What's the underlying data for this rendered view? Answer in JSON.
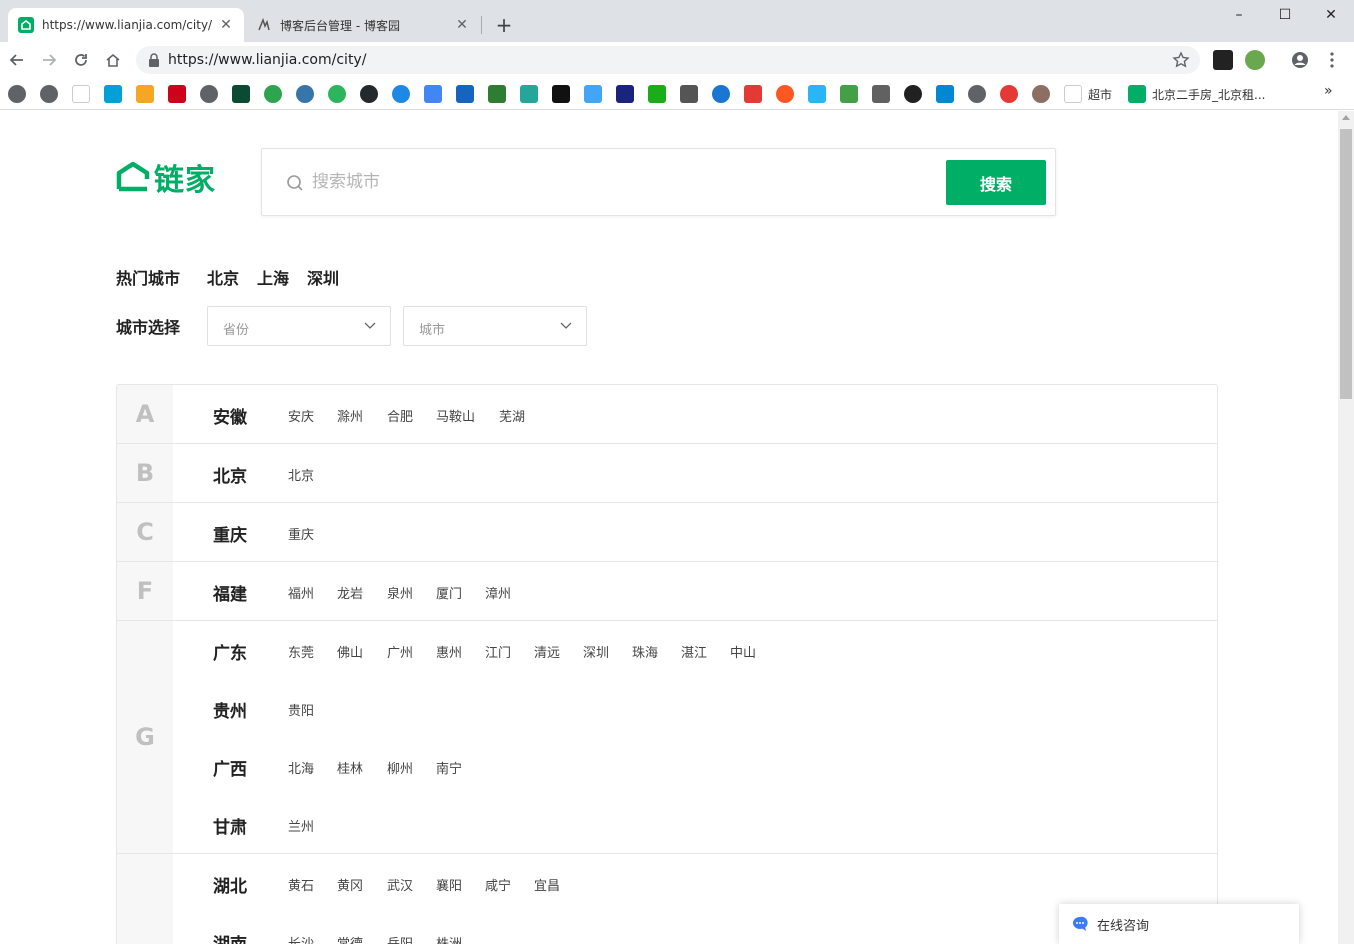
{
  "browser": {
    "tabs": [
      {
        "title": "https://www.lianjia.com/city/",
        "active": true
      },
      {
        "title": "博客后台管理 - 博客园",
        "active": false
      }
    ],
    "url": "https://www.lianjia.com/city/",
    "bookmarks": [
      {
        "label": "超市"
      },
      {
        "label": "北京二手房_北京租..."
      }
    ]
  },
  "site": {
    "logo_text": "链家",
    "brand_color": "#00ae66"
  },
  "search": {
    "placeholder": "搜索城市",
    "button_label": "搜索"
  },
  "hot": {
    "label": "热门城市",
    "cities": [
      "北京",
      "上海",
      "深圳"
    ]
  },
  "select": {
    "label": "城市选择",
    "province_placeholder": "省份",
    "city_placeholder": "城市"
  },
  "groups": [
    {
      "letter": "A",
      "provinces": [
        {
          "name": "安徽",
          "cities": [
            "安庆",
            "滁州",
            "合肥",
            "马鞍山",
            "芜湖"
          ]
        }
      ]
    },
    {
      "letter": "B",
      "provinces": [
        {
          "name": "北京",
          "cities": [
            "北京"
          ]
        }
      ]
    },
    {
      "letter": "C",
      "provinces": [
        {
          "name": "重庆",
          "cities": [
            "重庆"
          ]
        }
      ]
    },
    {
      "letter": "F",
      "provinces": [
        {
          "name": "福建",
          "cities": [
            "福州",
            "龙岩",
            "泉州",
            "厦门",
            "漳州"
          ]
        }
      ]
    },
    {
      "letter": "G",
      "provinces": [
        {
          "name": "广东",
          "cities": [
            "东莞",
            "佛山",
            "广州",
            "惠州",
            "江门",
            "清远",
            "深圳",
            "珠海",
            "湛江",
            "中山"
          ]
        },
        {
          "name": "贵州",
          "cities": [
            "贵阳"
          ]
        },
        {
          "name": "广西",
          "cities": [
            "北海",
            "桂林",
            "柳州",
            "南宁"
          ]
        },
        {
          "name": "甘肃",
          "cities": [
            "兰州"
          ]
        }
      ]
    },
    {
      "letter": "",
      "provinces": [
        {
          "name": "湖北",
          "cities": [
            "黄石",
            "黄冈",
            "武汉",
            "襄阳",
            "咸宁",
            "宜昌"
          ]
        },
        {
          "name": "湖南",
          "cities": [
            "长沙",
            "常德",
            "岳阳",
            "株洲"
          ]
        }
      ]
    }
  ],
  "chat": {
    "label": "在线咨询"
  }
}
